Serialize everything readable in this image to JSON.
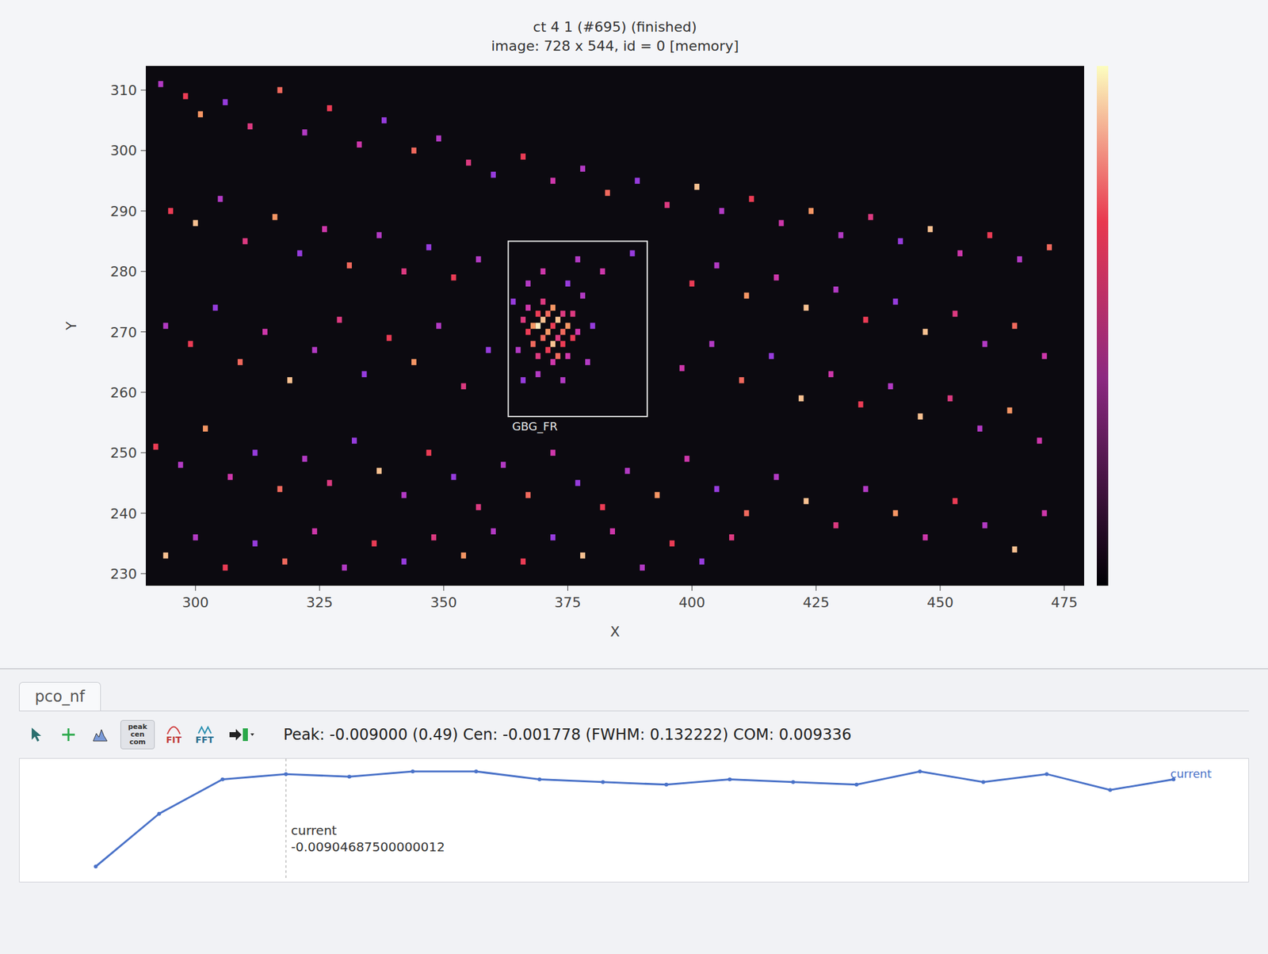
{
  "plot": {
    "title": "ct 4 1 (#695) (finished)",
    "subtitle": "image: 728 x 544, id = 0 [memory]",
    "xLabel": "X",
    "yLabel": "Y",
    "xTicks": [
      "300",
      "325",
      "350",
      "375",
      "400",
      "425",
      "450",
      "475"
    ],
    "yTicks": [
      "310",
      "300",
      "290",
      "280",
      "270",
      "260",
      "250",
      "240",
      "230"
    ],
    "xRange": [
      290,
      479
    ],
    "yRange": [
      228,
      314
    ],
    "roi": {
      "label": "GBG_FR",
      "x0": 363,
      "x1": 391,
      "y0": 256,
      "y1": 285
    },
    "pixels": [
      [
        293,
        311,
        0.3
      ],
      [
        298,
        309,
        0.6
      ],
      [
        301,
        306,
        0.8
      ],
      [
        306,
        308,
        0.2
      ],
      [
        311,
        304,
        0.5
      ],
      [
        317,
        310,
        0.7
      ],
      [
        322,
        303,
        0.3
      ],
      [
        327,
        307,
        0.6
      ],
      [
        333,
        301,
        0.4
      ],
      [
        338,
        305,
        0.2
      ],
      [
        344,
        300,
        0.7
      ],
      [
        349,
        302,
        0.3
      ],
      [
        355,
        298,
        0.5
      ],
      [
        360,
        296,
        0.2
      ],
      [
        366,
        299,
        0.6
      ],
      [
        372,
        295,
        0.4
      ],
      [
        378,
        297,
        0.3
      ],
      [
        383,
        293,
        0.7
      ],
      [
        389,
        295,
        0.2
      ],
      [
        395,
        291,
        0.5
      ],
      [
        401,
        294,
        0.9
      ],
      [
        406,
        290,
        0.3
      ],
      [
        412,
        292,
        0.6
      ],
      [
        418,
        288,
        0.4
      ],
      [
        424,
        290,
        0.8
      ],
      [
        430,
        286,
        0.3
      ],
      [
        436,
        289,
        0.5
      ],
      [
        442,
        285,
        0.2
      ],
      [
        448,
        287,
        0.9
      ],
      [
        454,
        283,
        0.4
      ],
      [
        460,
        286,
        0.6
      ],
      [
        466,
        282,
        0.3
      ],
      [
        472,
        284,
        0.7
      ],
      [
        295,
        290,
        0.6
      ],
      [
        300,
        288,
        0.9
      ],
      [
        305,
        292,
        0.3
      ],
      [
        310,
        285,
        0.5
      ],
      [
        316,
        289,
        0.8
      ],
      [
        321,
        283,
        0.2
      ],
      [
        326,
        287,
        0.4
      ],
      [
        331,
        281,
        0.7
      ],
      [
        337,
        286,
        0.3
      ],
      [
        342,
        280,
        0.5
      ],
      [
        347,
        284,
        0.2
      ],
      [
        352,
        279,
        0.6
      ],
      [
        357,
        282,
        0.3
      ],
      [
        382,
        280,
        0.4
      ],
      [
        388,
        283,
        0.2
      ],
      [
        400,
        278,
        0.6
      ],
      [
        405,
        281,
        0.3
      ],
      [
        411,
        276,
        0.8
      ],
      [
        417,
        279,
        0.4
      ],
      [
        423,
        274,
        0.9
      ],
      [
        429,
        277,
        0.3
      ],
      [
        435,
        272,
        0.6
      ],
      [
        441,
        275,
        0.2
      ],
      [
        447,
        270,
        0.9
      ],
      [
        453,
        273,
        0.5
      ],
      [
        459,
        268,
        0.3
      ],
      [
        465,
        271,
        0.7
      ],
      [
        471,
        266,
        0.4
      ],
      [
        294,
        271,
        0.3
      ],
      [
        299,
        268,
        0.6
      ],
      [
        304,
        274,
        0.2
      ],
      [
        309,
        265,
        0.7
      ],
      [
        314,
        270,
        0.4
      ],
      [
        319,
        262,
        0.9
      ],
      [
        324,
        267,
        0.3
      ],
      [
        329,
        272,
        0.5
      ],
      [
        334,
        263,
        0.2
      ],
      [
        339,
        269,
        0.6
      ],
      [
        344,
        265,
        0.8
      ],
      [
        349,
        271,
        0.3
      ],
      [
        354,
        261,
        0.5
      ],
      [
        359,
        267,
        0.2
      ],
      [
        398,
        264,
        0.4
      ],
      [
        404,
        268,
        0.3
      ],
      [
        410,
        262,
        0.7
      ],
      [
        416,
        266,
        0.2
      ],
      [
        422,
        259,
        0.9
      ],
      [
        428,
        263,
        0.4
      ],
      [
        434,
        258,
        0.6
      ],
      [
        440,
        261,
        0.3
      ],
      [
        446,
        256,
        0.9
      ],
      [
        452,
        259,
        0.5
      ],
      [
        458,
        254,
        0.3
      ],
      [
        464,
        257,
        0.8
      ],
      [
        470,
        252,
        0.4
      ],
      [
        292,
        251,
        0.6
      ],
      [
        297,
        248,
        0.3
      ],
      [
        302,
        254,
        0.8
      ],
      [
        307,
        246,
        0.4
      ],
      [
        312,
        250,
        0.2
      ],
      [
        317,
        244,
        0.7
      ],
      [
        322,
        249,
        0.3
      ],
      [
        327,
        245,
        0.5
      ],
      [
        332,
        252,
        0.2
      ],
      [
        337,
        247,
        0.9
      ],
      [
        342,
        243,
        0.3
      ],
      [
        347,
        250,
        0.6
      ],
      [
        352,
        246,
        0.2
      ],
      [
        357,
        241,
        0.5
      ],
      [
        362,
        248,
        0.3
      ],
      [
        367,
        243,
        0.7
      ],
      [
        372,
        250,
        0.4
      ],
      [
        377,
        245,
        0.2
      ],
      [
        382,
        241,
        0.6
      ],
      [
        387,
        247,
        0.3
      ],
      [
        393,
        243,
        0.8
      ],
      [
        399,
        249,
        0.4
      ],
      [
        405,
        244,
        0.2
      ],
      [
        411,
        240,
        0.7
      ],
      [
        417,
        246,
        0.3
      ],
      [
        423,
        242,
        0.9
      ],
      [
        429,
        238,
        0.5
      ],
      [
        435,
        244,
        0.3
      ],
      [
        441,
        240,
        0.8
      ],
      [
        447,
        236,
        0.4
      ],
      [
        453,
        242,
        0.6
      ],
      [
        459,
        238,
        0.3
      ],
      [
        465,
        234,
        0.9
      ],
      [
        471,
        240,
        0.4
      ],
      [
        294,
        233,
        0.9
      ],
      [
        300,
        236,
        0.3
      ],
      [
        306,
        231,
        0.6
      ],
      [
        312,
        235,
        0.2
      ],
      [
        318,
        232,
        0.7
      ],
      [
        324,
        237,
        0.4
      ],
      [
        330,
        231,
        0.3
      ],
      [
        336,
        235,
        0.6
      ],
      [
        342,
        232,
        0.2
      ],
      [
        348,
        236,
        0.5
      ],
      [
        354,
        233,
        0.8
      ],
      [
        360,
        237,
        0.3
      ],
      [
        366,
        232,
        0.6
      ],
      [
        372,
        236,
        0.2
      ],
      [
        378,
        233,
        0.9
      ],
      [
        384,
        237,
        0.4
      ],
      [
        390,
        231,
        0.3
      ],
      [
        396,
        235,
        0.6
      ],
      [
        402,
        232,
        0.2
      ],
      [
        408,
        236,
        0.5
      ],
      [
        366,
        272,
        0.5
      ],
      [
        367,
        270,
        0.6
      ],
      [
        367,
        274,
        0.4
      ],
      [
        368,
        268,
        0.7
      ],
      [
        368,
        271,
        0.8
      ],
      [
        369,
        273,
        0.6
      ],
      [
        369,
        266,
        0.5
      ],
      [
        370,
        269,
        0.7
      ],
      [
        370,
        272,
        0.9
      ],
      [
        370,
        275,
        0.5
      ],
      [
        371,
        267,
        0.6
      ],
      [
        371,
        270,
        0.8
      ],
      [
        371,
        273,
        0.7
      ],
      [
        372,
        265,
        0.4
      ],
      [
        372,
        268,
        0.9
      ],
      [
        372,
        271,
        0.6
      ],
      [
        372,
        274,
        0.8
      ],
      [
        373,
        266,
        0.7
      ],
      [
        373,
        269,
        0.5
      ],
      [
        373,
        272,
        0.9
      ],
      [
        374,
        268,
        0.6
      ],
      [
        374,
        270,
        0.7
      ],
      [
        374,
        273,
        0.5
      ],
      [
        375,
        266,
        0.4
      ],
      [
        375,
        271,
        0.8
      ],
      [
        376,
        269,
        0.6
      ],
      [
        376,
        273,
        0.5
      ],
      [
        377,
        270,
        0.4
      ],
      [
        369,
        263,
        0.3
      ],
      [
        374,
        262,
        0.3
      ],
      [
        365,
        267,
        0.3
      ],
      [
        378,
        276,
        0.3
      ],
      [
        367,
        278,
        0.3
      ],
      [
        375,
        278,
        0.2
      ],
      [
        379,
        265,
        0.3
      ],
      [
        364,
        275,
        0.2
      ],
      [
        370,
        280,
        0.4
      ],
      [
        380,
        271,
        0.2
      ],
      [
        366,
        262,
        0.2
      ],
      [
        377,
        282,
        0.3
      ],
      [
        369,
        271,
        1.0
      ]
    ]
  },
  "panel": {
    "tab": {
      "label": "pco_nf",
      "selected": true
    },
    "toolbar": [
      {
        "kind": "pointer",
        "text": ""
      },
      {
        "kind": "plus",
        "text": ""
      },
      {
        "kind": "histogram",
        "text": ""
      },
      {
        "kind": "stack",
        "text": "peak cen com"
      },
      {
        "kind": "fit",
        "text": "FIT"
      },
      {
        "kind": "fft",
        "text": "FFT"
      },
      {
        "kind": "export",
        "text": ""
      }
    ],
    "stats": "Peak: -0.009000 (0.49)  Cen: -0.001778 (FWHM: 0.132222) COM: 0.009336",
    "chart": {
      "series": [
        {
          "name": "current",
          "values": [
            -0.0125,
            -0.0105,
            -0.0092,
            -0.009,
            -0.0091,
            -0.0089,
            -0.0089,
            -0.0092,
            -0.0093,
            -0.0094,
            -0.0092,
            -0.0093,
            -0.0094,
            -0.0089,
            -0.0093,
            -0.009,
            -0.0096,
            -0.0092
          ]
        }
      ],
      "marker": {
        "index": 3,
        "label": "current",
        "value": "-0.00904687500000012"
      }
    }
  }
}
